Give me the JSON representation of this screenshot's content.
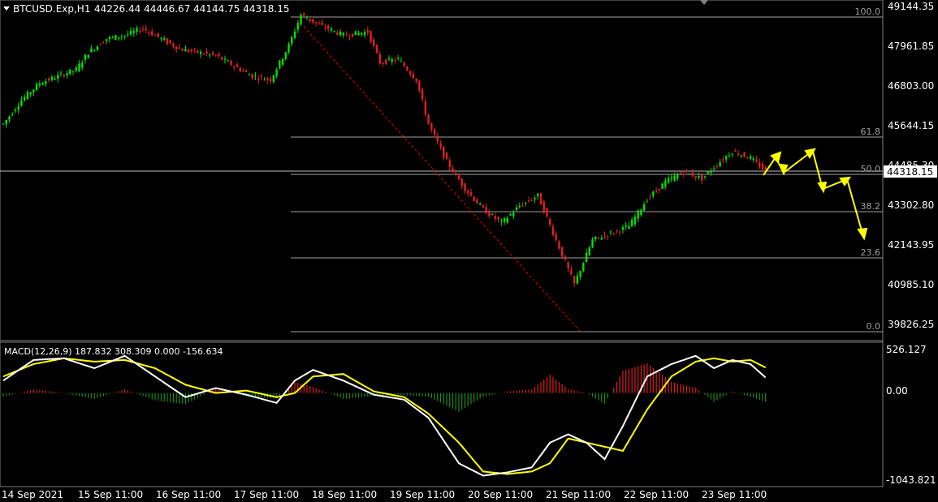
{
  "header": {
    "menu_icon": "triangle-down-icon",
    "symbol": "BTCUSD.Exp,H1",
    "ohlc": "44226.44 44446.67 44144.75 44318.15"
  },
  "price_axis": {
    "labels": [
      "49144.35",
      "47961.85",
      "46803.00",
      "45644.15",
      "44485.30",
      "43302.80",
      "42143.95",
      "40985.10",
      "39826.25"
    ],
    "current_price": "44318.15"
  },
  "fibonacci": {
    "levels": [
      "100.0",
      "61.8",
      "50.0",
      "38.2",
      "23.6",
      "0.0"
    ]
  },
  "macd": {
    "label": "MACD(12,26,9) 187.832 308.309 0.000 -156.634",
    "axis_labels": [
      "526.127",
      "0.00",
      "-1043.821"
    ]
  },
  "time_axis": {
    "labels": [
      "14 Sep 2021",
      "15 Sep 11:00",
      "16 Sep 11:00",
      "17 Sep 11:00",
      "18 Sep 11:00",
      "19 Sep 11:00",
      "20 Sep 11:00",
      "21 Sep 11:00",
      "22 Sep 11:00",
      "23 Sep 11:00"
    ]
  },
  "colors": {
    "background": "#000000",
    "bull": "#00e000",
    "bear": "#e02020",
    "macd_line": "#ffffff",
    "signal_line": "#ffff00",
    "forecast_arrows": "#ffff00",
    "fib_line": "#c0c0c0",
    "trend_line": "#ff0000"
  },
  "chart_data": {
    "type": "candlestick",
    "symbol": "BTCUSD",
    "timeframe": "H1",
    "x_range": [
      "14 Sep 2021",
      "23 Sep 2021"
    ],
    "ylim": [
      39826.25,
      49144.35
    ],
    "path_points": [
      {
        "t": 0,
        "p": 45700
      },
      {
        "t": 6,
        "p": 46400
      },
      {
        "t": 12,
        "p": 46900
      },
      {
        "t": 18,
        "p": 47100
      },
      {
        "t": 24,
        "p": 47300
      },
      {
        "t": 28,
        "p": 47800
      },
      {
        "t": 34,
        "p": 48200
      },
      {
        "t": 40,
        "p": 48300
      },
      {
        "t": 46,
        "p": 48500
      },
      {
        "t": 52,
        "p": 48200
      },
      {
        "t": 58,
        "p": 47900
      },
      {
        "t": 64,
        "p": 47800
      },
      {
        "t": 70,
        "p": 47700
      },
      {
        "t": 76,
        "p": 47400
      },
      {
        "t": 82,
        "p": 47100
      },
      {
        "t": 88,
        "p": 47000
      },
      {
        "t": 94,
        "p": 48000
      },
      {
        "t": 98,
        "p": 48900
      },
      {
        "t": 104,
        "p": 48600
      },
      {
        "t": 112,
        "p": 48300
      },
      {
        "t": 120,
        "p": 48400
      },
      {
        "t": 124,
        "p": 47500
      },
      {
        "t": 130,
        "p": 47600
      },
      {
        "t": 136,
        "p": 47000
      },
      {
        "t": 140,
        "p": 45700
      },
      {
        "t": 146,
        "p": 44600
      },
      {
        "t": 152,
        "p": 43800
      },
      {
        "t": 158,
        "p": 43200
      },
      {
        "t": 164,
        "p": 42800
      },
      {
        "t": 170,
        "p": 43300
      },
      {
        "t": 176,
        "p": 43600
      },
      {
        "t": 182,
        "p": 42300
      },
      {
        "t": 188,
        "p": 41000
      },
      {
        "t": 194,
        "p": 42300
      },
      {
        "t": 200,
        "p": 42500
      },
      {
        "t": 206,
        "p": 42700
      },
      {
        "t": 212,
        "p": 43500
      },
      {
        "t": 218,
        "p": 44000
      },
      {
        "t": 224,
        "p": 44300
      },
      {
        "t": 230,
        "p": 44100
      },
      {
        "t": 236,
        "p": 44600
      },
      {
        "t": 240,
        "p": 44900
      },
      {
        "t": 246,
        "p": 44700
      },
      {
        "t": 251,
        "p": 44318
      }
    ],
    "macd_histogram_note": "histogram bars in red (positive) and green (negative)",
    "macd_points": [
      {
        "t": 0,
        "m": 150,
        "s": 200
      },
      {
        "t": 10,
        "m": 400,
        "s": 350
      },
      {
        "t": 20,
        "m": 420,
        "s": 420
      },
      {
        "t": 30,
        "m": 300,
        "s": 380
      },
      {
        "t": 40,
        "m": 450,
        "s": 400
      },
      {
        "t": 50,
        "m": 200,
        "s": 300
      },
      {
        "t": 60,
        "m": -50,
        "s": 100
      },
      {
        "t": 70,
        "m": 60,
        "s": 0
      },
      {
        "t": 80,
        "m": -20,
        "s": 30
      },
      {
        "t": 90,
        "m": -120,
        "s": -50
      },
      {
        "t": 96,
        "m": 150,
        "s": 0
      },
      {
        "t": 102,
        "m": 280,
        "s": 200
      },
      {
        "t": 112,
        "m": 150,
        "s": 230
      },
      {
        "t": 122,
        "m": -20,
        "s": 20
      },
      {
        "t": 132,
        "m": -80,
        "s": -50
      },
      {
        "t": 140,
        "m": -300,
        "s": -250
      },
      {
        "t": 150,
        "m": -850,
        "s": -600
      },
      {
        "t": 158,
        "m": -1000,
        "s": -950
      },
      {
        "t": 166,
        "m": -960,
        "s": -980
      },
      {
        "t": 174,
        "m": -900,
        "s": -950
      },
      {
        "t": 180,
        "m": -600,
        "s": -850
      },
      {
        "t": 186,
        "m": -500,
        "s": -550
      },
      {
        "t": 192,
        "m": -600,
        "s": -600
      },
      {
        "t": 198,
        "m": -800,
        "s": -650
      },
      {
        "t": 204,
        "m": -400,
        "s": -700
      },
      {
        "t": 212,
        "m": 200,
        "s": -200
      },
      {
        "t": 220,
        "m": 350,
        "s": 200
      },
      {
        "t": 228,
        "m": 450,
        "s": 380
      },
      {
        "t": 234,
        "m": 300,
        "s": 420
      },
      {
        "t": 240,
        "m": 400,
        "s": 380
      },
      {
        "t": 246,
        "m": 350,
        "s": 400
      },
      {
        "t": 251,
        "m": 188,
        "s": 308
      }
    ]
  }
}
